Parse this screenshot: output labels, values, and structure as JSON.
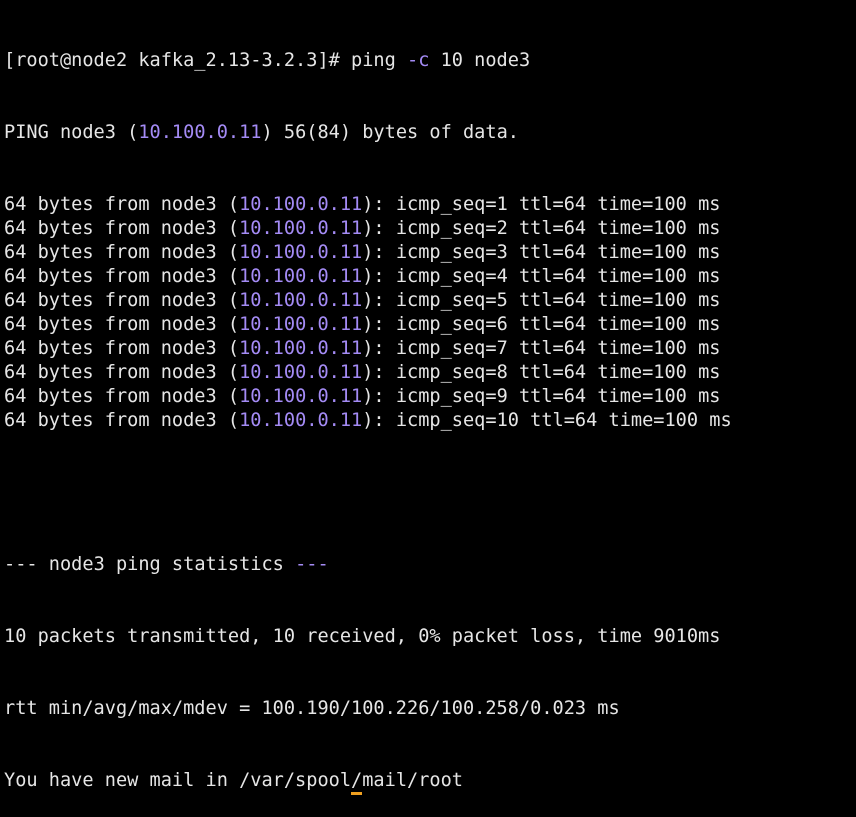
{
  "prompt": {
    "text": "[root@node2 kafka_2.13-3.2.3]# ping ",
    "flag": "-c",
    "args": " 10 node3"
  },
  "header": {
    "prefix": "PING node3 (",
    "ip": "10.100.0.11",
    "suffix": ") 56(84) bytes of data."
  },
  "replies": [
    {
      "prefix": "64 bytes from node3 (",
      "ip": "10.100.0.11",
      "suffix": "): icmp_seq=1 ttl=64 time=100 ms"
    },
    {
      "prefix": "64 bytes from node3 (",
      "ip": "10.100.0.11",
      "suffix": "): icmp_seq=2 ttl=64 time=100 ms"
    },
    {
      "prefix": "64 bytes from node3 (",
      "ip": "10.100.0.11",
      "suffix": "): icmp_seq=3 ttl=64 time=100 ms"
    },
    {
      "prefix": "64 bytes from node3 (",
      "ip": "10.100.0.11",
      "suffix": "): icmp_seq=4 ttl=64 time=100 ms"
    },
    {
      "prefix": "64 bytes from node3 (",
      "ip": "10.100.0.11",
      "suffix": "): icmp_seq=5 ttl=64 time=100 ms"
    },
    {
      "prefix": "64 bytes from node3 (",
      "ip": "10.100.0.11",
      "suffix": "): icmp_seq=6 ttl=64 time=100 ms"
    },
    {
      "prefix": "64 bytes from node3 (",
      "ip": "10.100.0.11",
      "suffix": "): icmp_seq=7 ttl=64 time=100 ms"
    },
    {
      "prefix": "64 bytes from node3 (",
      "ip": "10.100.0.11",
      "suffix": "): icmp_seq=8 ttl=64 time=100 ms"
    },
    {
      "prefix": "64 bytes from node3 (",
      "ip": "10.100.0.11",
      "suffix": "): icmp_seq=9 ttl=64 time=100 ms"
    },
    {
      "prefix": "64 bytes from node3 (",
      "ip": "10.100.0.11",
      "suffix": "): icmp_seq=10 ttl=64 time=100 ms"
    }
  ],
  "statistics": {
    "dashes_left": "---",
    "title": " node3 ping statistics ",
    "dashes_right": "---",
    "packets": "10 packets transmitted, 10 received, 0% packet loss, time 9010ms",
    "rtt": "rtt min/avg/max/mdev = 100.190/100.226/100.258/0.023 ms"
  },
  "mail_notice": {
    "before_cursor": "You have new mail in /var/spool",
    "cursor_char": "/",
    "after_cursor": "mail/root"
  },
  "colors": {
    "background": "#000000",
    "text": "#e6e6e6",
    "highlight": "#a48bf5",
    "cursor": "#f0a020"
  }
}
